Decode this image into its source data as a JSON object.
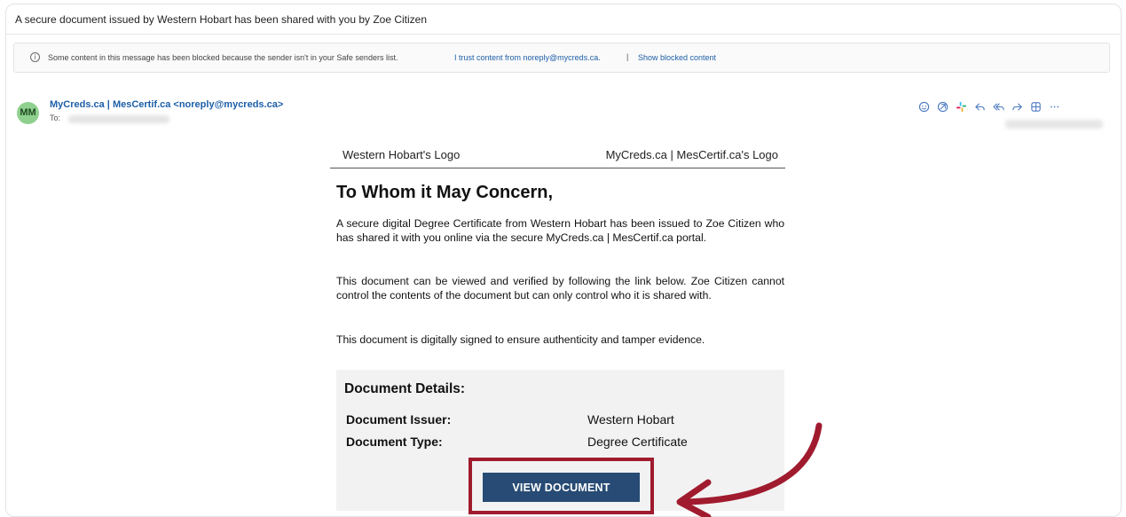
{
  "email": {
    "subject": "A secure document issued by Western Hobart has been shared with you by Zoe Citizen",
    "notice": {
      "text": "Some content in this message has been blocked because the sender isn't in your Safe senders list.",
      "trust_link": "I trust content from noreply@mycreds.ca.",
      "separator": "|",
      "show_link": "Show blocked content"
    },
    "sender": {
      "initials": "MM",
      "display": "MyCreds.ca | MesCertif.ca <noreply@mycreds.ca>",
      "to_label": "To:"
    },
    "actions": [
      "emoji-icon",
      "loop-icon",
      "slack-icon",
      "reply-icon",
      "reply-all-icon",
      "forward-icon",
      "apps-icon",
      "more-icon"
    ],
    "body": {
      "logo_left": "Western Hobart's Logo",
      "logo_right": "MyCreds.ca | MesCertif.ca's Logo",
      "greeting": "To Whom it May Concern,",
      "paragraph1": "A secure digital Degree Certificate from Western Hobart has been issued to Zoe Citizen who has shared it with you online via the secure MyCreds.ca | MesCertif.ca portal.",
      "paragraph2": "This document can be viewed and verified by following the link below. Zoe Citizen cannot control the contents of the document but can only control who it is shared with.",
      "paragraph3": "This document is digitally signed to ensure authenticity and tamper evidence.",
      "details": {
        "title": "Document Details:",
        "issuer_label": "Document Issuer:",
        "issuer_value": "Western Hobart",
        "type_label": "Document Type:",
        "type_value": "Degree Certificate"
      },
      "button_label": "VIEW DOCUMENT"
    }
  },
  "colors": {
    "link": "#1d5fa8",
    "button": "#274b74",
    "highlight": "#a01b2e",
    "avatar": "#8fd08f",
    "details_bg": "#f2f2f2"
  }
}
